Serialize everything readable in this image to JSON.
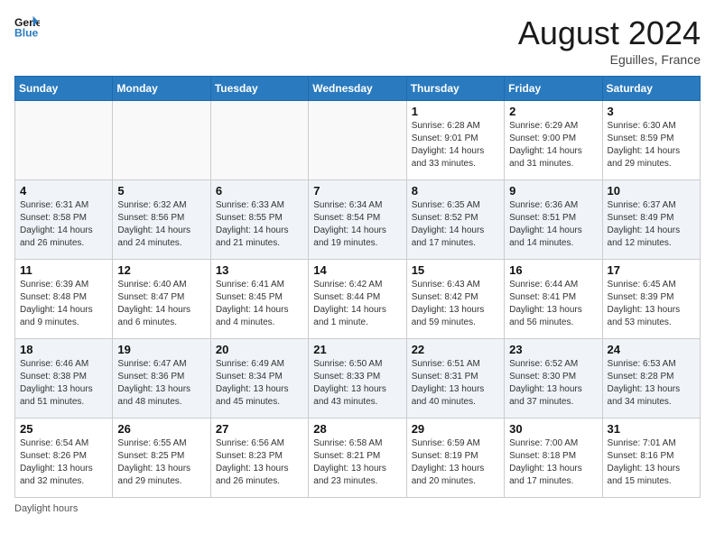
{
  "header": {
    "logo_line1": "General",
    "logo_line2": "Blue",
    "month_year": "August 2024",
    "location": "Eguilles, France"
  },
  "days_of_week": [
    "Sunday",
    "Monday",
    "Tuesday",
    "Wednesday",
    "Thursday",
    "Friday",
    "Saturday"
  ],
  "weeks": [
    [
      {
        "day": "",
        "content": ""
      },
      {
        "day": "",
        "content": ""
      },
      {
        "day": "",
        "content": ""
      },
      {
        "day": "",
        "content": ""
      },
      {
        "day": "1",
        "content": "Sunrise: 6:28 AM\nSunset: 9:01 PM\nDaylight: 14 hours\nand 33 minutes."
      },
      {
        "day": "2",
        "content": "Sunrise: 6:29 AM\nSunset: 9:00 PM\nDaylight: 14 hours\nand 31 minutes."
      },
      {
        "day": "3",
        "content": "Sunrise: 6:30 AM\nSunset: 8:59 PM\nDaylight: 14 hours\nand 29 minutes."
      }
    ],
    [
      {
        "day": "4",
        "content": "Sunrise: 6:31 AM\nSunset: 8:58 PM\nDaylight: 14 hours\nand 26 minutes."
      },
      {
        "day": "5",
        "content": "Sunrise: 6:32 AM\nSunset: 8:56 PM\nDaylight: 14 hours\nand 24 minutes."
      },
      {
        "day": "6",
        "content": "Sunrise: 6:33 AM\nSunset: 8:55 PM\nDaylight: 14 hours\nand 21 minutes."
      },
      {
        "day": "7",
        "content": "Sunrise: 6:34 AM\nSunset: 8:54 PM\nDaylight: 14 hours\nand 19 minutes."
      },
      {
        "day": "8",
        "content": "Sunrise: 6:35 AM\nSunset: 8:52 PM\nDaylight: 14 hours\nand 17 minutes."
      },
      {
        "day": "9",
        "content": "Sunrise: 6:36 AM\nSunset: 8:51 PM\nDaylight: 14 hours\nand 14 minutes."
      },
      {
        "day": "10",
        "content": "Sunrise: 6:37 AM\nSunset: 8:49 PM\nDaylight: 14 hours\nand 12 minutes."
      }
    ],
    [
      {
        "day": "11",
        "content": "Sunrise: 6:39 AM\nSunset: 8:48 PM\nDaylight: 14 hours\nand 9 minutes."
      },
      {
        "day": "12",
        "content": "Sunrise: 6:40 AM\nSunset: 8:47 PM\nDaylight: 14 hours\nand 6 minutes."
      },
      {
        "day": "13",
        "content": "Sunrise: 6:41 AM\nSunset: 8:45 PM\nDaylight: 14 hours\nand 4 minutes."
      },
      {
        "day": "14",
        "content": "Sunrise: 6:42 AM\nSunset: 8:44 PM\nDaylight: 14 hours\nand 1 minute."
      },
      {
        "day": "15",
        "content": "Sunrise: 6:43 AM\nSunset: 8:42 PM\nDaylight: 13 hours\nand 59 minutes."
      },
      {
        "day": "16",
        "content": "Sunrise: 6:44 AM\nSunset: 8:41 PM\nDaylight: 13 hours\nand 56 minutes."
      },
      {
        "day": "17",
        "content": "Sunrise: 6:45 AM\nSunset: 8:39 PM\nDaylight: 13 hours\nand 53 minutes."
      }
    ],
    [
      {
        "day": "18",
        "content": "Sunrise: 6:46 AM\nSunset: 8:38 PM\nDaylight: 13 hours\nand 51 minutes."
      },
      {
        "day": "19",
        "content": "Sunrise: 6:47 AM\nSunset: 8:36 PM\nDaylight: 13 hours\nand 48 minutes."
      },
      {
        "day": "20",
        "content": "Sunrise: 6:49 AM\nSunset: 8:34 PM\nDaylight: 13 hours\nand 45 minutes."
      },
      {
        "day": "21",
        "content": "Sunrise: 6:50 AM\nSunset: 8:33 PM\nDaylight: 13 hours\nand 43 minutes."
      },
      {
        "day": "22",
        "content": "Sunrise: 6:51 AM\nSunset: 8:31 PM\nDaylight: 13 hours\nand 40 minutes."
      },
      {
        "day": "23",
        "content": "Sunrise: 6:52 AM\nSunset: 8:30 PM\nDaylight: 13 hours\nand 37 minutes."
      },
      {
        "day": "24",
        "content": "Sunrise: 6:53 AM\nSunset: 8:28 PM\nDaylight: 13 hours\nand 34 minutes."
      }
    ],
    [
      {
        "day": "25",
        "content": "Sunrise: 6:54 AM\nSunset: 8:26 PM\nDaylight: 13 hours\nand 32 minutes."
      },
      {
        "day": "26",
        "content": "Sunrise: 6:55 AM\nSunset: 8:25 PM\nDaylight: 13 hours\nand 29 minutes."
      },
      {
        "day": "27",
        "content": "Sunrise: 6:56 AM\nSunset: 8:23 PM\nDaylight: 13 hours\nand 26 minutes."
      },
      {
        "day": "28",
        "content": "Sunrise: 6:58 AM\nSunset: 8:21 PM\nDaylight: 13 hours\nand 23 minutes."
      },
      {
        "day": "29",
        "content": "Sunrise: 6:59 AM\nSunset: 8:19 PM\nDaylight: 13 hours\nand 20 minutes."
      },
      {
        "day": "30",
        "content": "Sunrise: 7:00 AM\nSunset: 8:18 PM\nDaylight: 13 hours\nand 17 minutes."
      },
      {
        "day": "31",
        "content": "Sunrise: 7:01 AM\nSunset: 8:16 PM\nDaylight: 13 hours\nand 15 minutes."
      }
    ]
  ],
  "footer": {
    "daylight_label": "Daylight hours"
  }
}
